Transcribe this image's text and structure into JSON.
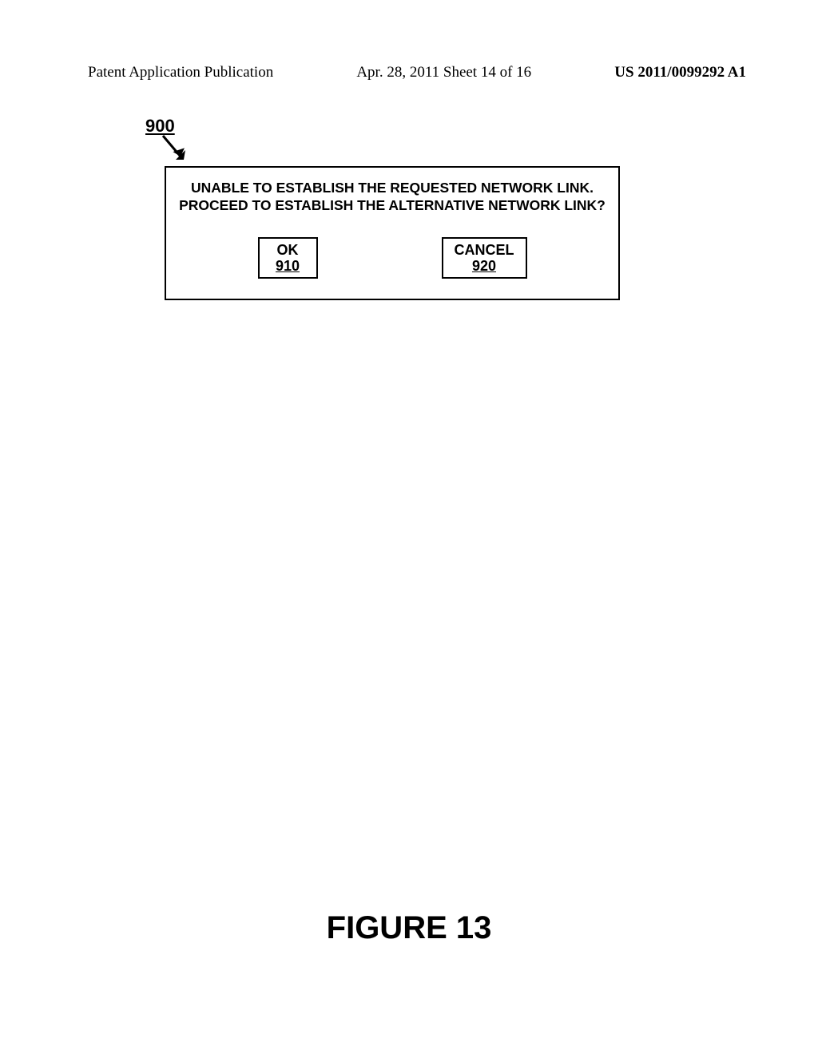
{
  "header": {
    "left": "Patent Application Publication",
    "center": "Apr. 28, 2011  Sheet 14 of 16",
    "right": "US 2011/0099292 A1"
  },
  "figure_ref": "900",
  "dialog": {
    "message_line1": "UNABLE TO ESTABLISH THE REQUESTED NETWORK LINK.",
    "message_line2": "PROCEED TO ESTABLISH THE ALTERNATIVE NETWORK LINK?",
    "ok": {
      "label": "OK",
      "ref": "910"
    },
    "cancel": {
      "label": "CANCEL",
      "ref": "920"
    }
  },
  "caption": "FIGURE 13"
}
